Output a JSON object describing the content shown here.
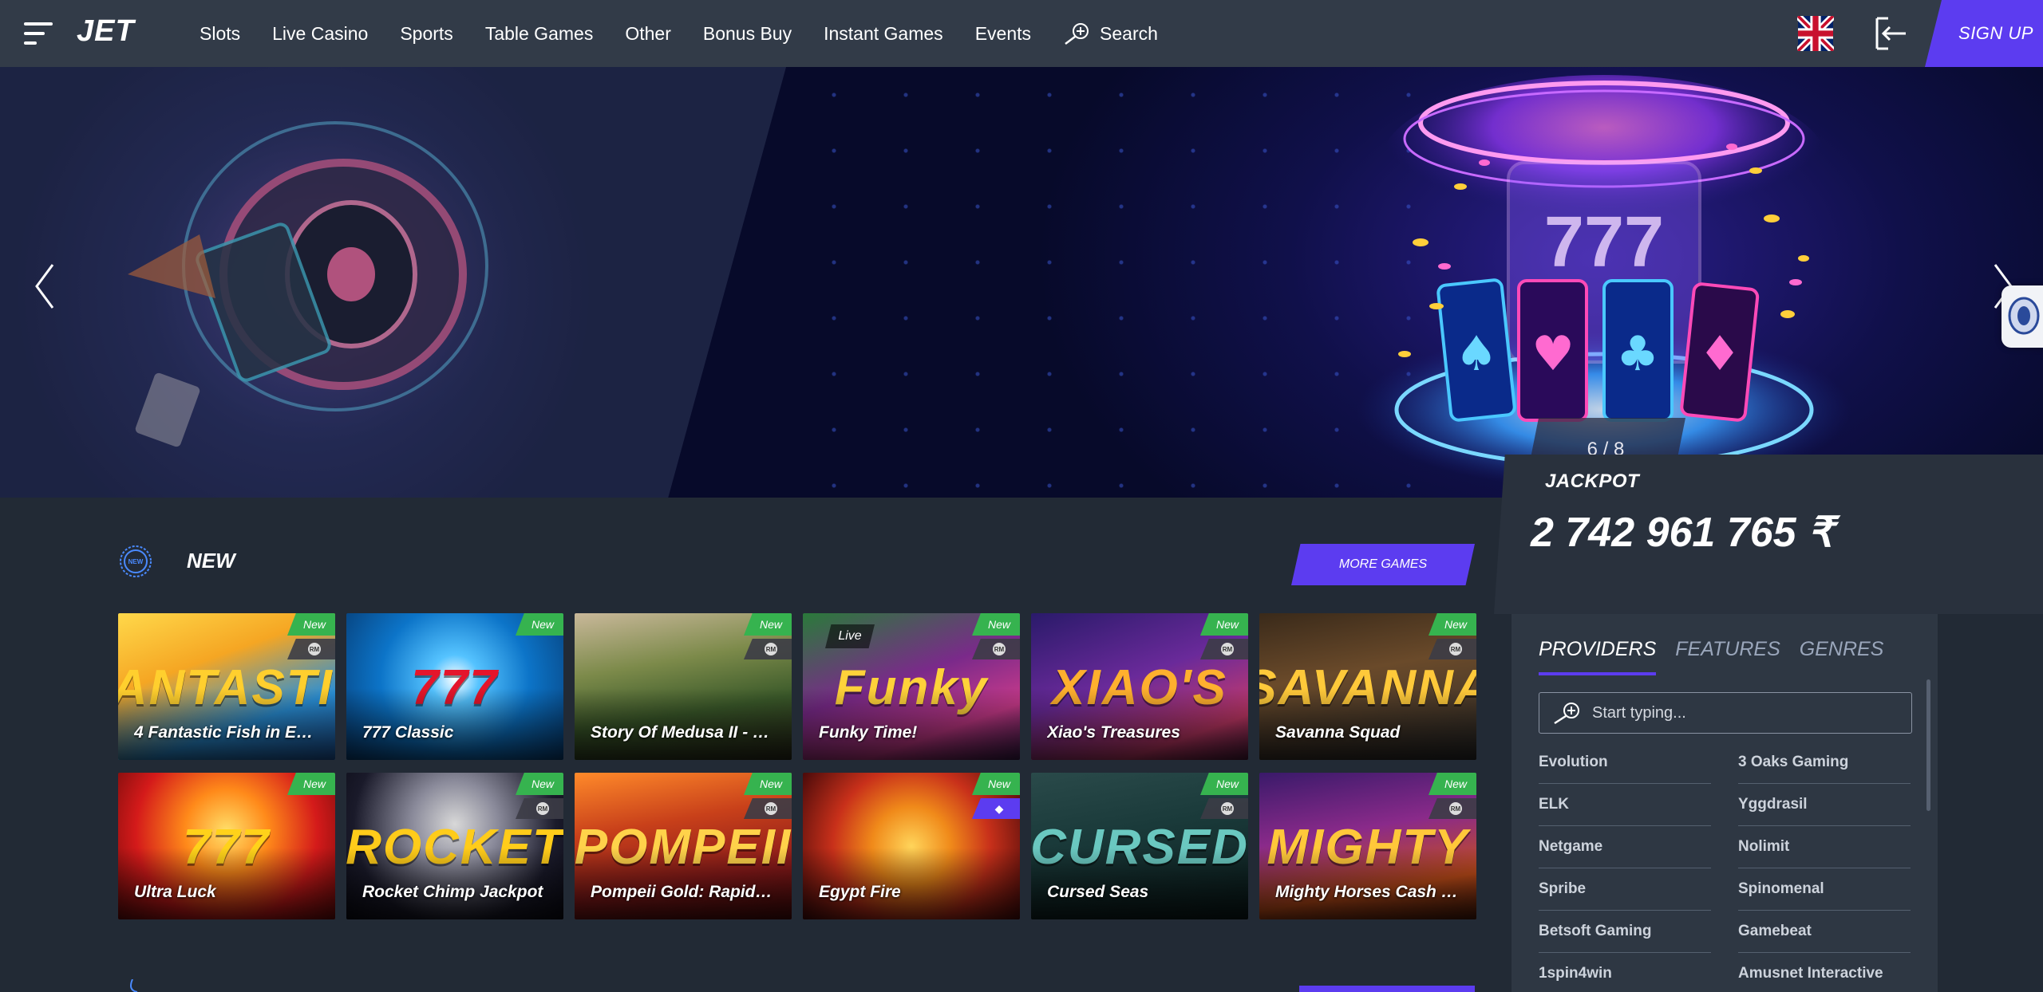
{
  "header": {
    "logo": "JET",
    "nav": [
      "Slots",
      "Live Casino",
      "Sports",
      "Table Games",
      "Other",
      "Bonus Buy",
      "Instant Games",
      "Events"
    ],
    "search_label": "Search",
    "signup_label": "SIGN UP",
    "language_flag": "uk-flag-icon",
    "login_icon": "login-icon"
  },
  "hero": {
    "slide_counter": "6 / 8",
    "prev_icon": "chevron-left-icon",
    "next_icon": "chevron-right-icon"
  },
  "jackpot": {
    "title": "JACKPOT",
    "value": "2 742 961 765 ₹"
  },
  "section": {
    "badge_text": "NEW",
    "title": "NEW",
    "more_label": "MORE GAMES"
  },
  "games": [
    {
      "title": "4 Fantastic Fish in Eg…",
      "art": "FANTASTIC",
      "new": "New",
      "badge": "rm",
      "live": "",
      "bg": "linear-gradient(160deg,#ffd84a 0%,#f5a623 35%,#2a8fd6 70%,#1d5aa6 100%)",
      "art_color": "#ffcf2e"
    },
    {
      "title": "777 Classic",
      "art": "777",
      "new": "New",
      "badge": "",
      "live": "",
      "bg": "radial-gradient(circle at 50% 45%,#ffffff 0%,#55c3ff 18%,#0c74c8 55%,#07407a 100%)",
      "art_color": "#e4152b"
    },
    {
      "title": "Story Of Medusa II - T…",
      "art": "",
      "new": "New",
      "badge": "rm",
      "live": "",
      "bg": "linear-gradient(170deg,#c9b89a 0%,#7c8a4a 35%,#3b5a2a 65%,#2a2a1a 100%)",
      "art_color": "#fff"
    },
    {
      "title": "Funky Time!",
      "art": "Funky",
      "new": "New",
      "badge": "rm",
      "live": "Live",
      "bg": "linear-gradient(160deg,#2a7a3a 0%,#7a2a8a 45%,#c83a8a 75%,#3a1a4a 100%)",
      "art_color": "#ffd23a"
    },
    {
      "title": "Xiao's Treasures",
      "art": "XIAO'S",
      "new": "New",
      "badge": "rm",
      "live": "",
      "bg": "linear-gradient(160deg,#2a1a6a 0%,#6a2a9a 45%,#c83a6a 80%,#4a1a3a 100%)",
      "art_color": "#ffb02e"
    },
    {
      "title": "Savanna Squad",
      "art": "SAVANNA",
      "new": "New",
      "badge": "rm",
      "live": "",
      "bg": "linear-gradient(170deg,#3a2a1a 0%,#6a4a2a 40%,#2a2a2a 100%)",
      "art_color": "#ffc93a"
    },
    {
      "title": "Ultra Luck",
      "art": "777",
      "new": "New",
      "badge": "",
      "live": "",
      "bg": "radial-gradient(circle at 50% 40%,#ffe06a 0%,#ff8a1a 30%,#d41a1a 65%,#6a0a0a 100%)",
      "art_color": "#ffd21a"
    },
    {
      "title": "Rocket Chimp Jackpot",
      "art": "ROCKET",
      "new": "New",
      "badge": "rm",
      "live": "",
      "bg": "radial-gradient(circle at 50% 35%,#d8d8d8 0%,#8a8a9a 30%,#1a1a2a 70%,#0a0a14 100%)",
      "art_color": "#ffcc1a"
    },
    {
      "title": "Pompeii Gold: Rapid …",
      "art": "POMPEII",
      "new": "New",
      "badge": "rm",
      "live": "",
      "bg": "linear-gradient(170deg,#ff8a2a 0%,#c8401a 35%,#8a1a1a 70%,#4a0a0a 100%)",
      "art_color": "#ffd24a"
    },
    {
      "title": "Egypt Fire",
      "art": "",
      "new": "New",
      "badge": "gem",
      "live": "",
      "bg": "radial-gradient(circle at 50% 50%,#ffd45a 0%,#f08a1a 30%,#c8301a 60%,#4a0a0a 100%)",
      "art_color": "#fff"
    },
    {
      "title": "Cursed Seas",
      "art": "CURSED",
      "new": "New",
      "badge": "rm",
      "live": "",
      "bg": "linear-gradient(170deg,#2a4a4a 0%,#1a3a3a 40%,#0a1a1a 100%)",
      "art_color": "#6ac8c0"
    },
    {
      "title": "Mighty Horses Cash C…",
      "art": "MIGHTY",
      "new": "New",
      "badge": "rm",
      "live": "",
      "bg": "linear-gradient(170deg,#3a1a6a 0%,#8a2a8a 40%,#c8501a 75%,#4a1a0a 100%)",
      "art_color": "#ffc83a"
    }
  ],
  "filter": {
    "tabs": [
      "PROVIDERS",
      "FEATURES",
      "GENRES"
    ],
    "active_tab": "PROVIDERS",
    "search_placeholder": "Start typing...",
    "providers": [
      "Evolution",
      "3 Oaks Gaming",
      "ELK",
      "Yggdrasil",
      "Netgame",
      "Nolimit",
      "Spribe",
      "Spinomenal",
      "Betsoft Gaming",
      "Gamebeat",
      "1spin4win",
      "Amusnet Interactive"
    ]
  },
  "colors": {
    "header_bg": "#323b48",
    "page_bg": "#222a35",
    "accent": "#5c3cf0",
    "new_badge": "#36b34f"
  }
}
